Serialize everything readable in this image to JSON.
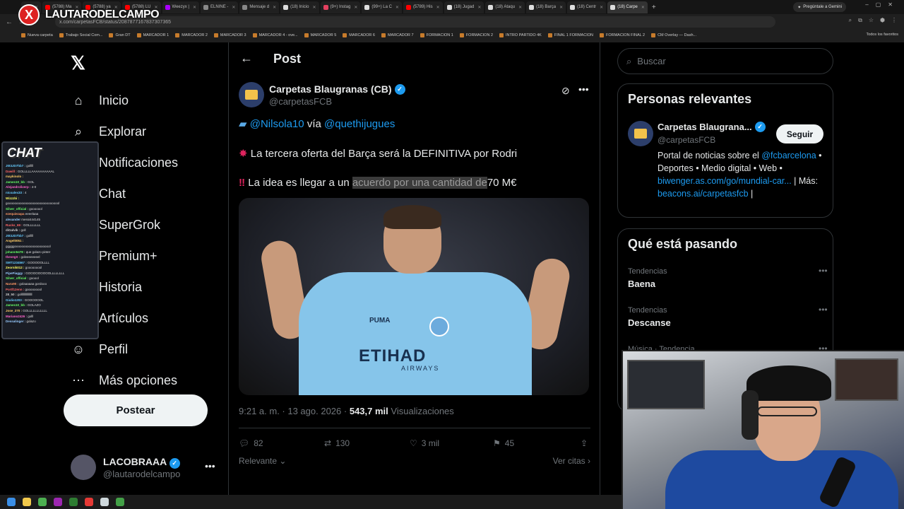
{
  "browser": {
    "tabs": [
      {
        "label": "",
        "color": "#d22"
      },
      {
        "label": "(5788) Ma",
        "color": "#f00"
      },
      {
        "label": "(5788) ya",
        "color": "#f00"
      },
      {
        "label": "(5788) LU",
        "color": "#f00"
      },
      {
        "label": "Weezyx |",
        "color": "#a0f"
      },
      {
        "label": "ELNINE -",
        "color": "#888"
      },
      {
        "label": "Mensaje d",
        "color": "#888"
      },
      {
        "label": "(18) Inicio",
        "color": "#ddd"
      },
      {
        "label": "(9+) Instag",
        "color": "#e4405f"
      },
      {
        "label": "(99+) La C",
        "color": "#ddd"
      },
      {
        "label": "(5789) His",
        "color": "#f00"
      },
      {
        "label": "(18) Jugad",
        "color": "#ddd"
      },
      {
        "label": "(18) Ataqu",
        "color": "#ddd"
      },
      {
        "label": "(18) Barça",
        "color": "#ddd"
      },
      {
        "label": "(18) Centr",
        "color": "#ddd"
      },
      {
        "label": "(18) Carpe",
        "color": "#ddd",
        "active": true
      }
    ],
    "gemini_label": "Pregúntale a Gemini",
    "url": "x.com/carpetasFCB/status/2087877167837307365",
    "bookmarks": [
      "Nueva carpeta",
      "Trabajo Social Com...",
      "Gran DT",
      "MARCADOR 1",
      "MARCADOR 2",
      "MARCADOR 3",
      "MARCADOR 4 - ove...",
      "MARCADOR 5",
      "MARCADOR 6",
      "MARCADOR 7",
      "FORMACION 1",
      "FORMACION 2",
      "INTRO PARTIDO 4K",
      "FINAL 1 FORMACION",
      "FORMACION FINAL 2",
      "CM Overlay — Dash..."
    ],
    "all_bookmarks": "Todos los favoritos"
  },
  "overlay": {
    "channel_logo": "X",
    "channel_name": "LAUTARODELCAMPO",
    "chat_title": "CHAT",
    "chat_lines": [
      {
        "user": "J0t3JD7hb7 :",
        "msg": "golllll",
        "color": "#6cf"
      },
      {
        "user": "Dawill :",
        "msg": "GOLLLLLAAAAAAAAAAL",
        "color": "#f66"
      },
      {
        "user": "maykinolo :",
        "msg": "",
        "color": "#fc6"
      },
      {
        "user": "James10_bb :",
        "msg": "GOL",
        "color": "#6f6"
      },
      {
        "user": "Alejandroliverp :",
        "msg": "4-0",
        "color": "#f6c"
      },
      {
        "user": "nicoalex33 :",
        "msg": "4",
        "color": "#6cf"
      },
      {
        "user": "Wizzzbi :",
        "msg": "",
        "color": "#ff6"
      },
      {
        "user": "",
        "msg": "goooooooooooooooooooooooooooool",
        "color": "#ddd"
      },
      {
        "user": "Silver_official :",
        "msg": "gooooool",
        "color": "#6f6"
      },
      {
        "user": "ezequiezapa",
        "msg": "eeeelaaa",
        "color": "#f96"
      },
      {
        "user": "alexander",
        "msg": "messi444145",
        "color": "#9cf"
      },
      {
        "user": "Rucks_69 :",
        "msg": "GOLLLLLLL",
        "color": "#f66"
      },
      {
        "user": "diGalvik :",
        "msg": "goll",
        "color": "#ccc"
      },
      {
        "user": "J0t3JD7hb7 :",
        "msg": "golllll",
        "color": "#6cf"
      },
      {
        "user": "Angel0051 :",
        "msg": "",
        "color": "#fc6"
      },
      {
        "user": "",
        "msg": "gggggooooooooooooooooooool",
        "color": "#ddd"
      },
      {
        "user": "johann5478 :",
        "msg": "que golazo pinter",
        "color": "#6f6"
      },
      {
        "user": "thevegX :",
        "msg": "goleeeeeeeel",
        "color": "#f6c"
      },
      {
        "user": "SMT1234567 :",
        "msg": "GOOOOOLLLL",
        "color": "#6cf"
      },
      {
        "user": "Zeornik012 :",
        "msg": "gooooooool",
        "color": "#ff6"
      },
      {
        "user": "PipePiaggy :",
        "msg": "GOOOOOOOOOLLLLLLLL",
        "color": "#9cf"
      },
      {
        "user": "Silver_official :",
        "msg": "gooool",
        "color": "#6f6"
      },
      {
        "user": "Naru90 :",
        "msg": "golaaaaaa gordooo",
        "color": "#f96"
      },
      {
        "user": "Portf12enn :",
        "msg": "gooooooool",
        "color": "#f66"
      },
      {
        "user": "28_50 :",
        "msg": "gollllllllllllllll",
        "color": "#ccc"
      },
      {
        "user": "Giulio1203 :",
        "msg": "GOOOOOOL",
        "color": "#6cf"
      },
      {
        "user": "James10_bb :",
        "msg": "GOLAZO",
        "color": "#6f6"
      },
      {
        "user": "Jose_270 :",
        "msg": "GOLLLLLLLLLLL",
        "color": "#fc6"
      },
      {
        "user": "Mariano2426 :",
        "msg": "golll",
        "color": "#f6c"
      },
      {
        "user": "Dessalinger :",
        "msg": "golazo",
        "color": "#9cf"
      }
    ]
  },
  "sidebar": {
    "items": [
      {
        "label": "Inicio",
        "icon": "home-icon"
      },
      {
        "label": "Explorar",
        "icon": "search-icon"
      },
      {
        "label": "Notificaciones",
        "icon": "bell-icon"
      },
      {
        "label": "Chat",
        "icon": "chat-icon"
      },
      {
        "label": "SuperGrok",
        "icon": "grok-icon"
      },
      {
        "label": "Premium+",
        "icon": "premium-icon"
      },
      {
        "label": "Historia",
        "icon": "bookmark-icon"
      },
      {
        "label": "Artículos",
        "icon": "articles-icon"
      },
      {
        "label": "Perfil",
        "icon": "profile-icon"
      },
      {
        "label": "Más opciones",
        "icon": "more-options-icon"
      }
    ],
    "notif_badge": "15",
    "post_button": "Postear",
    "account": {
      "name": "LACOBRAAA",
      "handle": "@lautarodelcampo"
    }
  },
  "post": {
    "header_title": "Post",
    "author_name": "Carpetas Blaugranas (CB)",
    "author_handle": "@carpetasFCB",
    "line1_mention1": "@Nilsola10",
    "line1_via": "vía",
    "line1_mention2": "@quethijugues",
    "line2": "La tercera oferta del Barça será la DEFINITIVA por Rodri",
    "line3_a": "La idea es llegar a un",
    "line3_b": "acuerdo por una cantidad de",
    "line3_c": "70 M€",
    "image": {
      "sponsor": "ETIHAD",
      "sponsor_sub": "AIRWAYS",
      "brand": "PUMA"
    },
    "time": "9:21 a. m. · 13 ago. 2026 ·",
    "views": "543,7 mil",
    "views_label": "Visualizaciones",
    "replies": "82",
    "reposts": "130",
    "likes": "3 mil",
    "bookmarks": "45",
    "sort_label": "Relevante",
    "quotes_label": "Ver citas"
  },
  "right": {
    "search_placeholder": "Buscar",
    "relevant_title": "Personas relevantes",
    "person": {
      "name": "Carpetas Blaugrana...",
      "handle": "@carpetasFCB",
      "follow": "Seguir",
      "bio_1": "Portal de noticias sobre el",
      "bio_link1": "@fcbarcelona",
      "bio_2": "• Deportes • Medio digital • Web •",
      "bio_link2": "biwenger.as.com/go/mundial-car...",
      "bio_3": "Más:",
      "bio_link3": "beacons.ai/carpetasfcb"
    },
    "trending_title": "Qué está pasando",
    "trends": [
      {
        "meta": "Tendencias",
        "name": "Baena"
      },
      {
        "meta": "Tendencias",
        "name": "Descanse"
      },
      {
        "meta": "Música · Tendencia",
        "name": ""
      }
    ]
  },
  "colors": {
    "accent": "#1d9bf0",
    "background": "#000000",
    "border": "#2f3336",
    "muted": "#71767b"
  }
}
